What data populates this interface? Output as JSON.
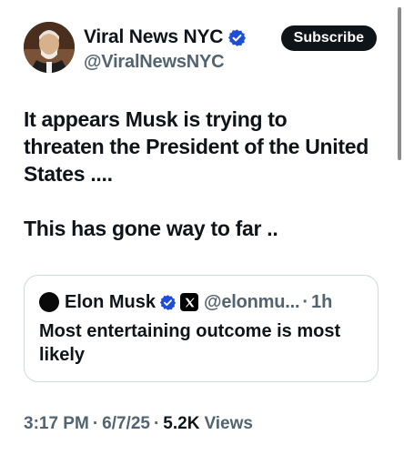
{
  "author": {
    "display_name": "Viral News NYC",
    "handle": "@ViralNewsNYC",
    "avatar_icon": "avatar-photo",
    "verified_icon": "verified-badge-icon"
  },
  "subscribe_label": "Subscribe",
  "tweet": {
    "paragraphs": [
      "It appears Musk is trying to threaten the President of the United States ....",
      "This has gone way to far .."
    ]
  },
  "quote": {
    "display_name": "Elon Musk",
    "handle": "@elonmu...",
    "separator": "·",
    "time": "1h",
    "text": "Most entertaining outcome is most likely"
  },
  "meta": {
    "time": "3:17 PM",
    "sep1": "·",
    "date": "6/7/25",
    "sep2": "·",
    "views_count": "5.2K",
    "views_label": "Views"
  },
  "colors": {
    "verified": "#1d9bf0",
    "verified_quote": "#1d4ed8",
    "secondary_text": "#536471",
    "primary_text": "#0f1419"
  }
}
